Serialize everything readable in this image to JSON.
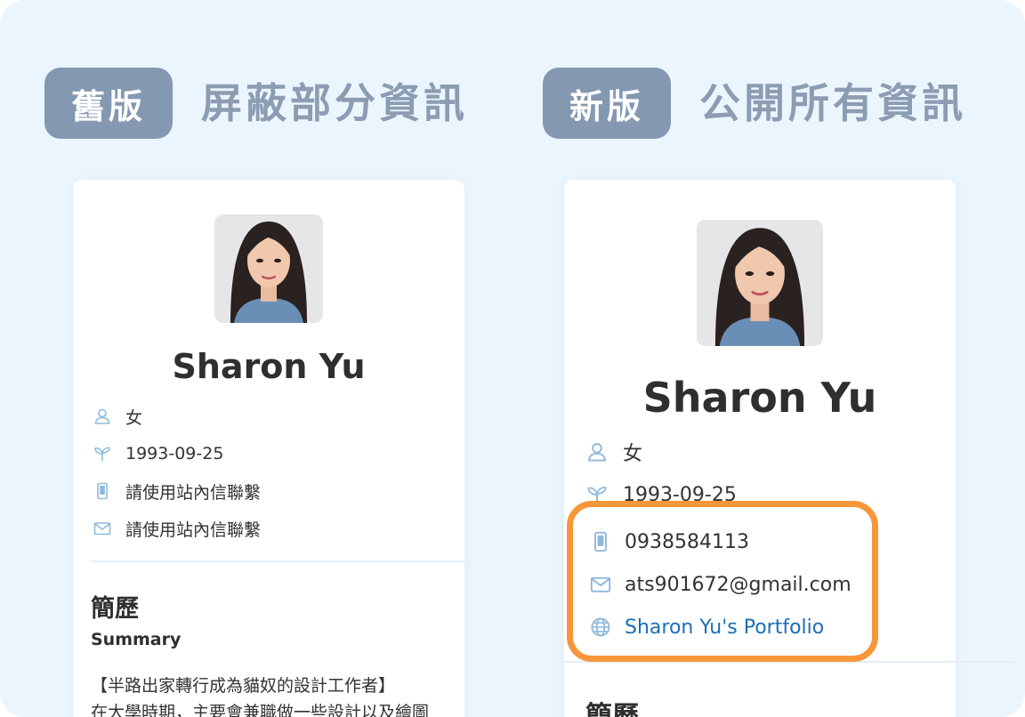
{
  "old": {
    "badge": "舊版",
    "heading": "屏蔽部分資訊",
    "name": "Sharon Yu",
    "gender": "女",
    "birthday": "1993-09-25",
    "phone": "請使用站內信聯繫",
    "email": "請使用站內信聯繫",
    "section_title": "簡歷",
    "summary_label": "Summary",
    "summary_line1": "【半路出家轉行成為貓奴的設計工作者】",
    "summary_line2": "在大學時期，主要會兼職做一些設計以及繪圖"
  },
  "new": {
    "badge": "新版",
    "heading": "公開所有資訊",
    "name": "Sharon Yu",
    "gender": "女",
    "birthday": "1993-09-25",
    "phone": "0938584113",
    "email": "ats901672@gmail.com",
    "portfolio": "Sharon Yu's Portfolio",
    "section_title": "簡歷"
  },
  "icons": {
    "gender": "person-icon",
    "birthday": "sprout-icon",
    "phone": "mobile-phone-icon",
    "email": "envelope-icon",
    "website": "globe-icon"
  },
  "colors": {
    "background": "#ebf5fd",
    "badge": "#8498b1",
    "heading": "#8b9cb3",
    "icon": "#8fb9dc",
    "link": "#1a6fb8",
    "highlight_border": "#f7973a"
  }
}
